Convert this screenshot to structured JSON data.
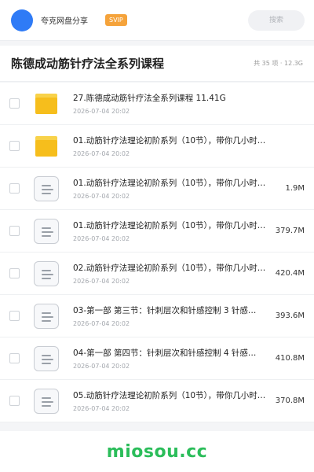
{
  "header": {
    "username": "夸克网盘分享",
    "badge": "SVIP",
    "search_placeholder": "搜索"
  },
  "folder": {
    "title": "陈德成动筋针疗法全系列课程",
    "summary": "共 35 项 · 12.3G"
  },
  "files": [
    {
      "type": "folder",
      "icon": "folder-icon",
      "name": "27.陈德成动筋针疗法全系列课程 11.41G",
      "date": "2026-07-04 20:02",
      "size": ""
    },
    {
      "type": "folder",
      "icon": "folder-icon",
      "name": "01.动筋针疗法理论初阶系列（10节），带你几小时…",
      "date": "2026-07-04 20:02",
      "size": ""
    },
    {
      "type": "file",
      "icon": "document-icon",
      "name": "01.动筋针疗法理论初阶系列（10节），带你几小时…",
      "date": "2026-07-04 20:02",
      "size": "1.9M"
    },
    {
      "type": "file",
      "icon": "document-icon",
      "name": "01.动筋针疗法理论初阶系列（10节），带你几小时…",
      "date": "2026-07-04 20:02",
      "size": "379.7M"
    },
    {
      "type": "file",
      "icon": "document-icon",
      "name": "02.动筋针疗法理论初阶系列（10节），带你几小时…",
      "date": "2026-07-04 20:02",
      "size": "420.4M"
    },
    {
      "type": "file",
      "icon": "document-icon",
      "name": "03-第一部 第三节：针刺层次和针感控制 3 针感…",
      "date": "2026-07-04 20:02",
      "size": "393.6M"
    },
    {
      "type": "file",
      "icon": "document-icon",
      "name": "04-第一部 第四节：针刺层次和针感控制 4 针感…",
      "date": "2026-07-04 20:02",
      "size": "410.8M"
    },
    {
      "type": "file",
      "icon": "document-icon",
      "name": "05.动筋针疗法理论初阶系列（10节），带你几小时…",
      "date": "2026-07-04 20:02",
      "size": "370.8M"
    }
  ],
  "watermark": "miosou.cc",
  "colors": {
    "accent": "#2f7bf6",
    "badge": "#f5a33b",
    "folder": "#f6be1c",
    "watermark": "#2bbd5a"
  }
}
